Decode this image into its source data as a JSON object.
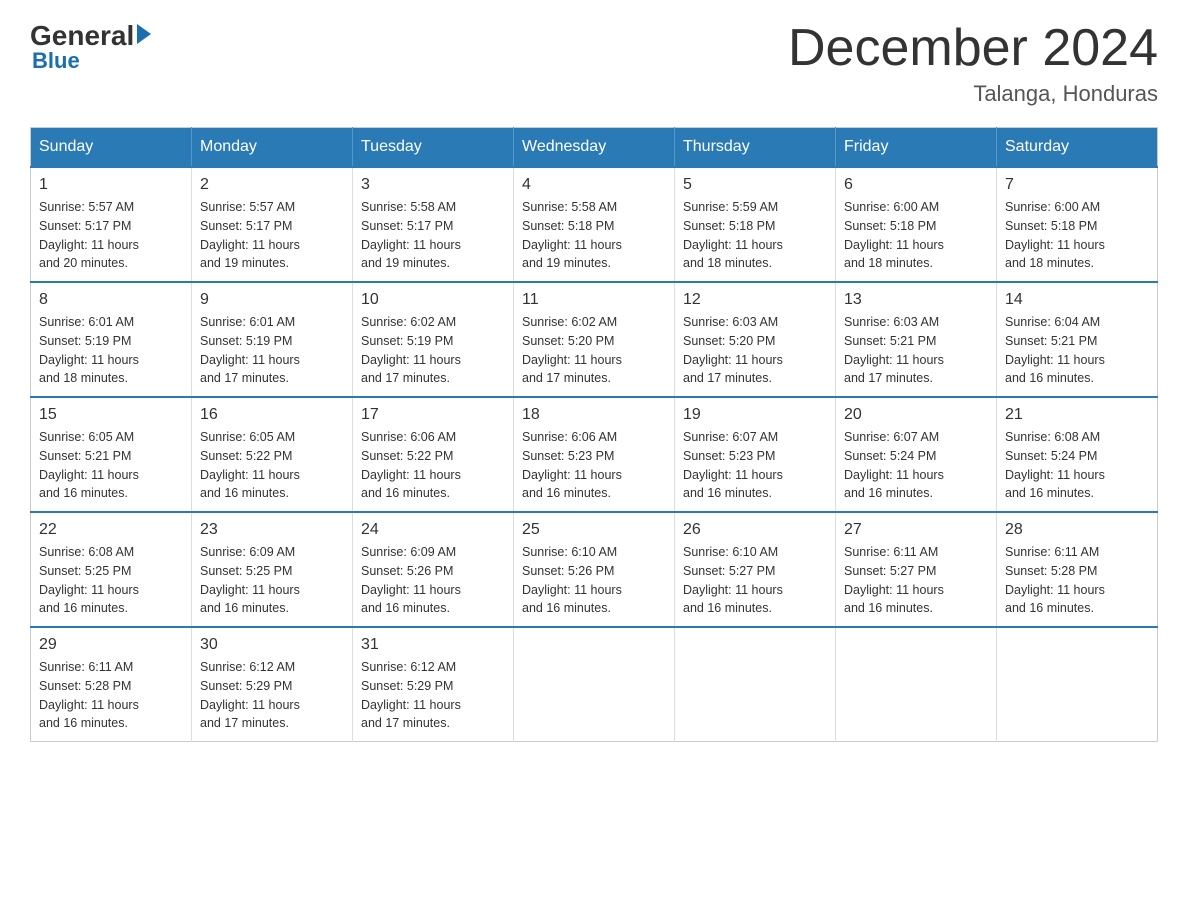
{
  "logo": {
    "general": "General",
    "blue": "Blue"
  },
  "title": "December 2024",
  "location": "Talanga, Honduras",
  "days_header": [
    "Sunday",
    "Monday",
    "Tuesday",
    "Wednesday",
    "Thursday",
    "Friday",
    "Saturday"
  ],
  "weeks": [
    [
      {
        "day": "1",
        "info": "Sunrise: 5:57 AM\nSunset: 5:17 PM\nDaylight: 11 hours\nand 20 minutes."
      },
      {
        "day": "2",
        "info": "Sunrise: 5:57 AM\nSunset: 5:17 PM\nDaylight: 11 hours\nand 19 minutes."
      },
      {
        "day": "3",
        "info": "Sunrise: 5:58 AM\nSunset: 5:17 PM\nDaylight: 11 hours\nand 19 minutes."
      },
      {
        "day": "4",
        "info": "Sunrise: 5:58 AM\nSunset: 5:18 PM\nDaylight: 11 hours\nand 19 minutes."
      },
      {
        "day": "5",
        "info": "Sunrise: 5:59 AM\nSunset: 5:18 PM\nDaylight: 11 hours\nand 18 minutes."
      },
      {
        "day": "6",
        "info": "Sunrise: 6:00 AM\nSunset: 5:18 PM\nDaylight: 11 hours\nand 18 minutes."
      },
      {
        "day": "7",
        "info": "Sunrise: 6:00 AM\nSunset: 5:18 PM\nDaylight: 11 hours\nand 18 minutes."
      }
    ],
    [
      {
        "day": "8",
        "info": "Sunrise: 6:01 AM\nSunset: 5:19 PM\nDaylight: 11 hours\nand 18 minutes."
      },
      {
        "day": "9",
        "info": "Sunrise: 6:01 AM\nSunset: 5:19 PM\nDaylight: 11 hours\nand 17 minutes."
      },
      {
        "day": "10",
        "info": "Sunrise: 6:02 AM\nSunset: 5:19 PM\nDaylight: 11 hours\nand 17 minutes."
      },
      {
        "day": "11",
        "info": "Sunrise: 6:02 AM\nSunset: 5:20 PM\nDaylight: 11 hours\nand 17 minutes."
      },
      {
        "day": "12",
        "info": "Sunrise: 6:03 AM\nSunset: 5:20 PM\nDaylight: 11 hours\nand 17 minutes."
      },
      {
        "day": "13",
        "info": "Sunrise: 6:03 AM\nSunset: 5:21 PM\nDaylight: 11 hours\nand 17 minutes."
      },
      {
        "day": "14",
        "info": "Sunrise: 6:04 AM\nSunset: 5:21 PM\nDaylight: 11 hours\nand 16 minutes."
      }
    ],
    [
      {
        "day": "15",
        "info": "Sunrise: 6:05 AM\nSunset: 5:21 PM\nDaylight: 11 hours\nand 16 minutes."
      },
      {
        "day": "16",
        "info": "Sunrise: 6:05 AM\nSunset: 5:22 PM\nDaylight: 11 hours\nand 16 minutes."
      },
      {
        "day": "17",
        "info": "Sunrise: 6:06 AM\nSunset: 5:22 PM\nDaylight: 11 hours\nand 16 minutes."
      },
      {
        "day": "18",
        "info": "Sunrise: 6:06 AM\nSunset: 5:23 PM\nDaylight: 11 hours\nand 16 minutes."
      },
      {
        "day": "19",
        "info": "Sunrise: 6:07 AM\nSunset: 5:23 PM\nDaylight: 11 hours\nand 16 minutes."
      },
      {
        "day": "20",
        "info": "Sunrise: 6:07 AM\nSunset: 5:24 PM\nDaylight: 11 hours\nand 16 minutes."
      },
      {
        "day": "21",
        "info": "Sunrise: 6:08 AM\nSunset: 5:24 PM\nDaylight: 11 hours\nand 16 minutes."
      }
    ],
    [
      {
        "day": "22",
        "info": "Sunrise: 6:08 AM\nSunset: 5:25 PM\nDaylight: 11 hours\nand 16 minutes."
      },
      {
        "day": "23",
        "info": "Sunrise: 6:09 AM\nSunset: 5:25 PM\nDaylight: 11 hours\nand 16 minutes."
      },
      {
        "day": "24",
        "info": "Sunrise: 6:09 AM\nSunset: 5:26 PM\nDaylight: 11 hours\nand 16 minutes."
      },
      {
        "day": "25",
        "info": "Sunrise: 6:10 AM\nSunset: 5:26 PM\nDaylight: 11 hours\nand 16 minutes."
      },
      {
        "day": "26",
        "info": "Sunrise: 6:10 AM\nSunset: 5:27 PM\nDaylight: 11 hours\nand 16 minutes."
      },
      {
        "day": "27",
        "info": "Sunrise: 6:11 AM\nSunset: 5:27 PM\nDaylight: 11 hours\nand 16 minutes."
      },
      {
        "day": "28",
        "info": "Sunrise: 6:11 AM\nSunset: 5:28 PM\nDaylight: 11 hours\nand 16 minutes."
      }
    ],
    [
      {
        "day": "29",
        "info": "Sunrise: 6:11 AM\nSunset: 5:28 PM\nDaylight: 11 hours\nand 16 minutes."
      },
      {
        "day": "30",
        "info": "Sunrise: 6:12 AM\nSunset: 5:29 PM\nDaylight: 11 hours\nand 17 minutes."
      },
      {
        "day": "31",
        "info": "Sunrise: 6:12 AM\nSunset: 5:29 PM\nDaylight: 11 hours\nand 17 minutes."
      },
      {
        "day": "",
        "info": ""
      },
      {
        "day": "",
        "info": ""
      },
      {
        "day": "",
        "info": ""
      },
      {
        "day": "",
        "info": ""
      }
    ]
  ]
}
